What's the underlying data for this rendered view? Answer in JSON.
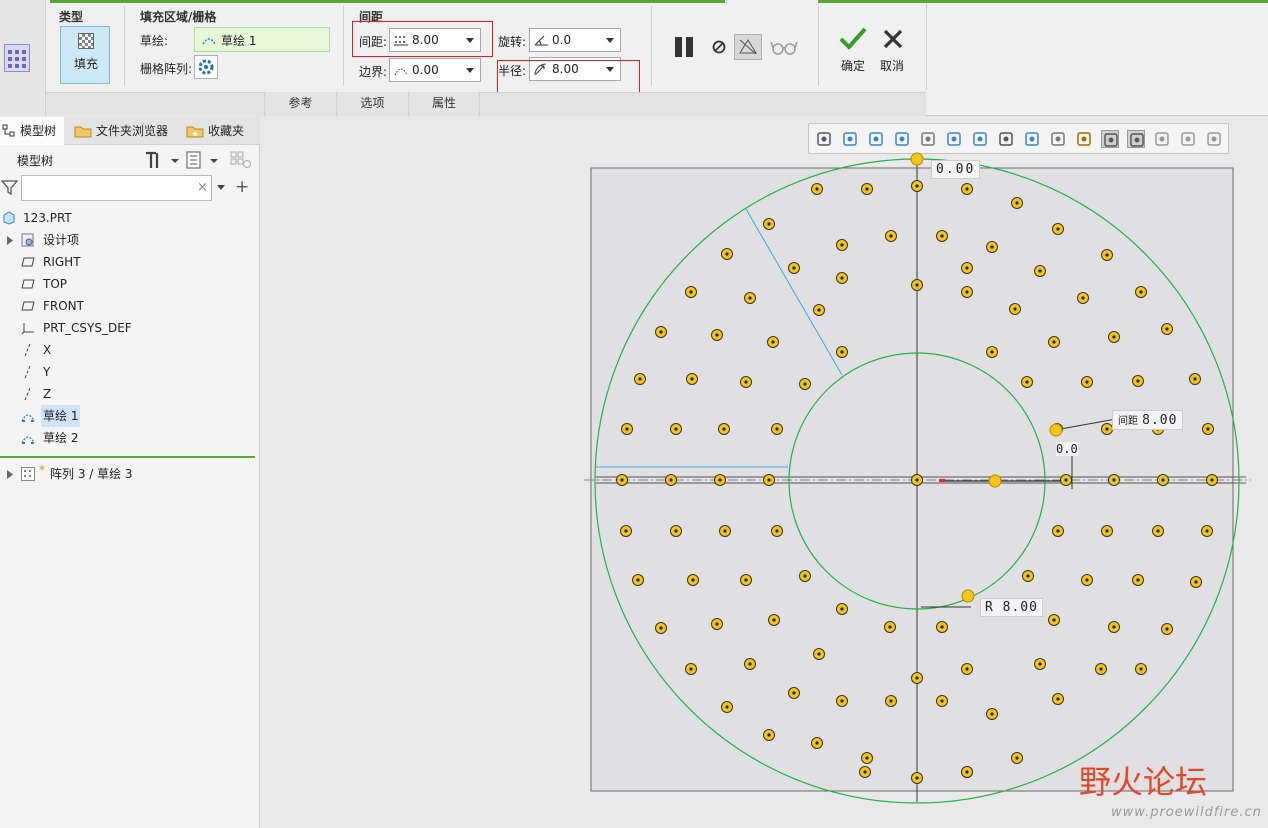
{
  "ribbon": {
    "groups": {
      "type_title": "类型",
      "fill_region_title": "填充区域/栅格",
      "spacing_title": "间距"
    },
    "fill_button": "填充",
    "sketch_label": "草绘:",
    "sketch_value": "草绘 1",
    "grid_array_label": "栅格阵列:",
    "spacing_label": "间距:",
    "spacing_value": "8.00",
    "border_label": "边界:",
    "border_value": "0.00",
    "rotation_label": "旋转:",
    "rotation_value": "0.0",
    "radius_label": "半径:",
    "radius_value": "8.00",
    "ok_label": "确定",
    "cancel_label": "取消",
    "tabs": [
      "参考",
      "选项",
      "属性"
    ]
  },
  "panel": {
    "tabs": [
      "模型树",
      "文件夹浏览器",
      "收藏夹"
    ],
    "header": "模型树",
    "filter_placeholder": "",
    "tree": [
      {
        "label": "123.PRT",
        "icon": "part-icon"
      },
      {
        "label": "设计项",
        "icon": "design-items-icon"
      },
      {
        "label": "RIGHT",
        "icon": "datum-plane-icon"
      },
      {
        "label": "TOP",
        "icon": "datum-plane-icon"
      },
      {
        "label": "FRONT",
        "icon": "datum-plane-icon"
      },
      {
        "label": "PRT_CSYS_DEF",
        "icon": "csys-icon"
      },
      {
        "label": "X",
        "icon": "axis-icon"
      },
      {
        "label": "Y",
        "icon": "axis-icon"
      },
      {
        "label": "Z",
        "icon": "axis-icon"
      },
      {
        "label": "草绘 1",
        "icon": "sketch-icon"
      },
      {
        "label": "草绘 2",
        "icon": "sketch-icon"
      }
    ],
    "insert_item": "阵列 3 / 草绘 3"
  },
  "canvas": {
    "dim_top": "0.00",
    "dim_spacing_prefix": "间距",
    "dim_spacing_value": "8.00",
    "dim_angle": "0.0",
    "dim_radius_prefix": "R",
    "dim_radius_value": "8.00"
  },
  "watermark": {
    "title": "野火论坛",
    "url": "www.proewildfire.cn"
  },
  "colors": {
    "accent_green": "#5aa63a",
    "highlight_red": "#e02020",
    "point_yellow": "#f5c518",
    "circle_green": "#22b04a"
  }
}
